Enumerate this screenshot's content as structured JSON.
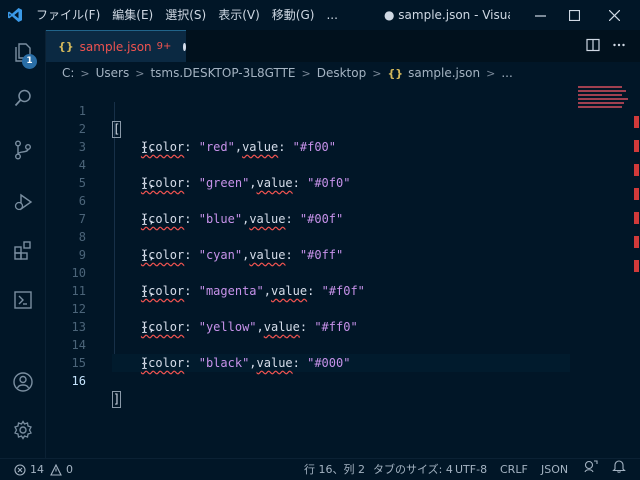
{
  "titlebar": {
    "menu": [
      "ファイル(F)",
      "編集(E)",
      "選択(S)",
      "表示(V)",
      "移動(G)",
      "..."
    ],
    "title": "● sample.json - Visual ..."
  },
  "activitybar": {
    "explorer_badge": "1"
  },
  "tab": {
    "icon": "{}",
    "name": "sample.json",
    "problems": "9+"
  },
  "breadcrumb": {
    "items": [
      "C:",
      "Users",
      "tsms.DESKTOP-3L8GTTE",
      "Desktop"
    ],
    "file_icon": "{}",
    "file": "sample.json",
    "more": "..."
  },
  "editor": {
    "active_line": 16,
    "lines": [
      {
        "n": "1",
        "code": "["
      },
      {
        "n": "2",
        "key1": "{color",
        "val1": "\"red\"",
        "key2": "value",
        "val2": "\"#f00\""
      },
      {
        "n": "3",
        "code": "    },"
      },
      {
        "n": "4",
        "key1": "{color",
        "val1": "\"green\"",
        "key2": "value",
        "val2": "\"#0f0\""
      },
      {
        "n": "5",
        "code": "    },"
      },
      {
        "n": "6",
        "key1": "{color",
        "val1": "\"blue\"",
        "key2": "value",
        "val2": "\"#00f\""
      },
      {
        "n": "7",
        "code": "    },"
      },
      {
        "n": "8",
        "key1": "{color",
        "val1": "\"cyan\"",
        "key2": "value",
        "val2": "\"#0ff\""
      },
      {
        "n": "9",
        "code": "    },"
      },
      {
        "n": "10",
        "key1": "{color",
        "val1": "\"magenta\"",
        "key2": "value",
        "val2": "\"#f0f\""
      },
      {
        "n": "11",
        "code": "    },"
      },
      {
        "n": "12",
        "key1": "{color",
        "val1": "\"yellow\"",
        "key2": "value",
        "val2": "\"#ff0\""
      },
      {
        "n": "13",
        "code": "    },"
      },
      {
        "n": "14",
        "key1": "{color",
        "val1": "\"black\"",
        "key2": "value",
        "val2": "\"#000\""
      },
      {
        "n": "15",
        "code": "    }"
      },
      {
        "n": "16",
        "code": "]"
      }
    ]
  },
  "statusbar": {
    "errors": "14",
    "warnings": "0",
    "position": "行 16、列 2",
    "tab_size": "タブのサイズ: 4",
    "encoding": "UTF-8",
    "eol": "CRLF",
    "language": "JSON"
  },
  "colors": {
    "background": "#011627",
    "string": "#c792ea",
    "error": "#ef5350",
    "accent": "#2a6ea6"
  }
}
